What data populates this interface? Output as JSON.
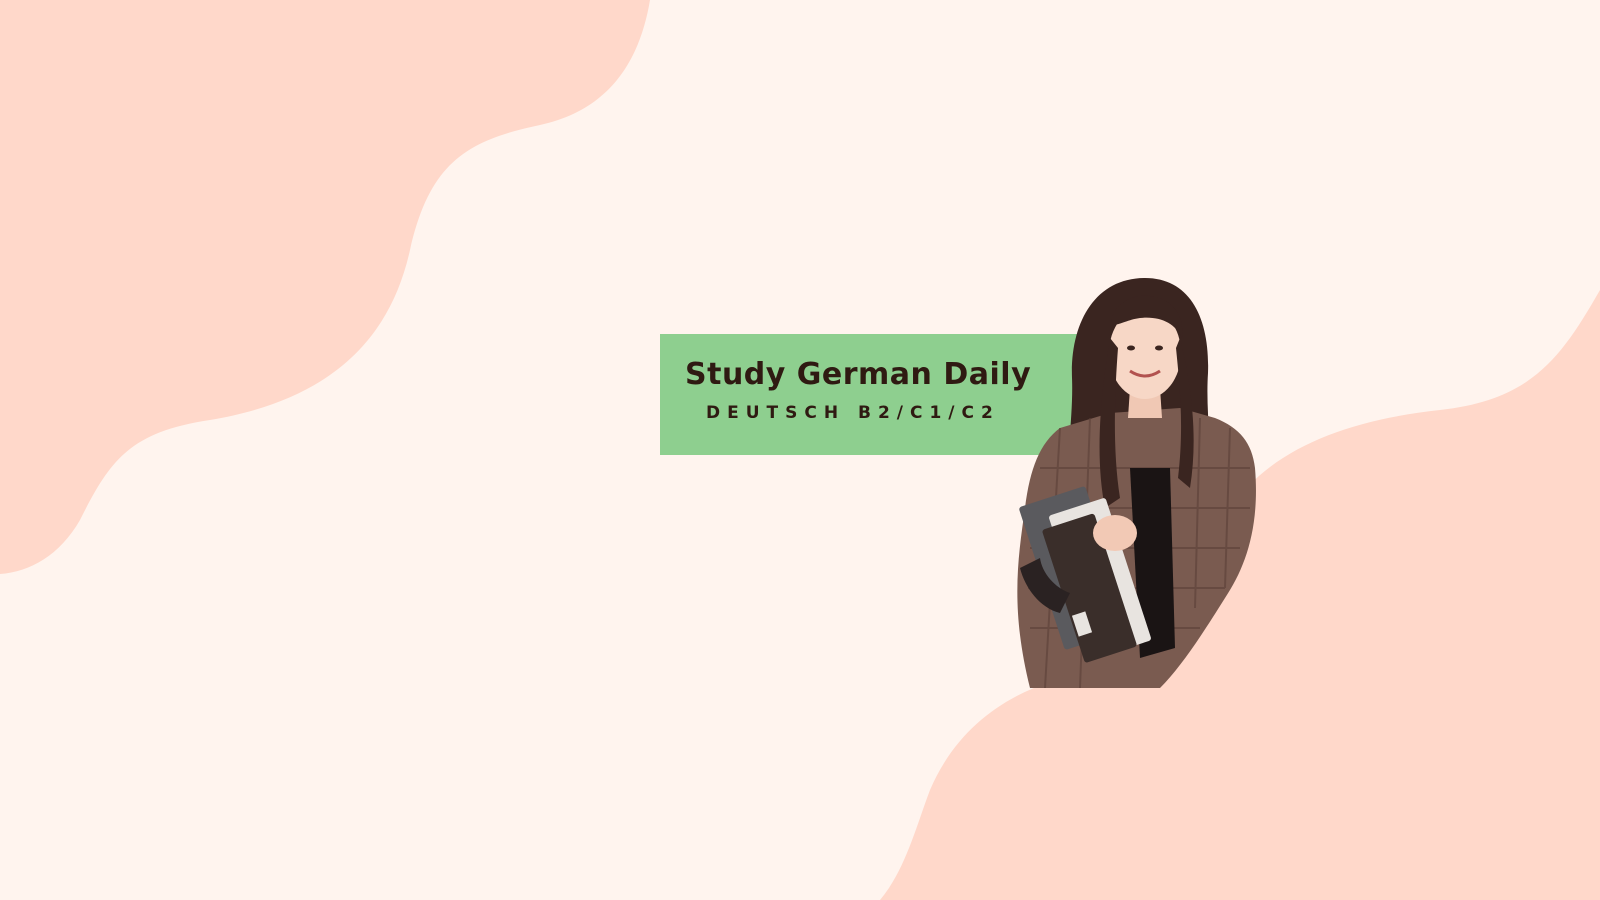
{
  "banner": {
    "title": "Study German Daily",
    "subtitle": "DEUTSCH B2/C1/C2"
  },
  "colors": {
    "background": "#fff4ee",
    "blob": "#ffd8ca",
    "title_box": "#8ecf8f",
    "title_text": "#2f1a12"
  },
  "icons": {
    "portrait": "woman-holding-books-photo"
  }
}
